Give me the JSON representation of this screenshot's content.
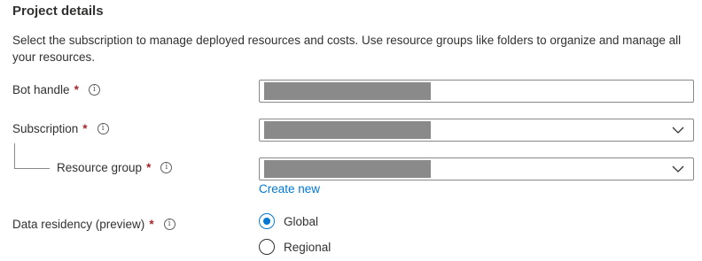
{
  "section": {
    "title": "Project details",
    "description": "Select the subscription to manage deployed resources and costs. Use resource groups like folders to organize and manage all your resources."
  },
  "fields": {
    "bot_handle": {
      "label": "Bot handle",
      "required": "*",
      "info": "i"
    },
    "subscription": {
      "label": "Subscription",
      "required": "*",
      "info": "i"
    },
    "resource_group": {
      "label": "Resource group",
      "required": "*",
      "info": "i",
      "create_new": "Create new"
    },
    "data_residency": {
      "label": "Data residency (preview)",
      "required": "*",
      "info": "i",
      "options": [
        "Global",
        "Regional"
      ],
      "selected": "Global"
    }
  },
  "colors": {
    "accent": "#0078d4",
    "required": "#a4262c",
    "redacted": "#8a8a8a"
  },
  "icons": {
    "info": "info-icon",
    "dropdown": "chevron-down-icon"
  }
}
